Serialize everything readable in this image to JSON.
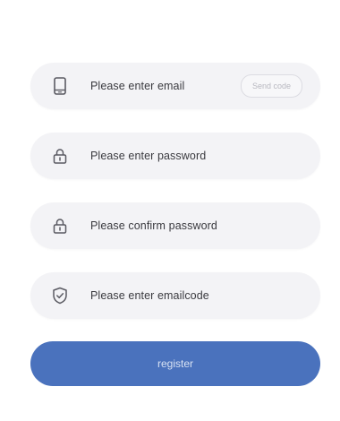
{
  "form": {
    "email": {
      "placeholder": "Please enter email",
      "icon": "phone-icon",
      "send_label": "Send code"
    },
    "password": {
      "placeholder": "Please enter password",
      "icon": "lock-icon"
    },
    "confirm_password": {
      "placeholder": "Please confirm password",
      "icon": "lock-icon"
    },
    "email_code": {
      "placeholder": "Please enter emailcode",
      "icon": "shield-check-icon"
    },
    "register_label": "register"
  },
  "colors": {
    "field_bg": "#f3f3f6",
    "primary": "#4a72bd",
    "text": "#3a3a3f",
    "icon": "#5a5a62"
  }
}
